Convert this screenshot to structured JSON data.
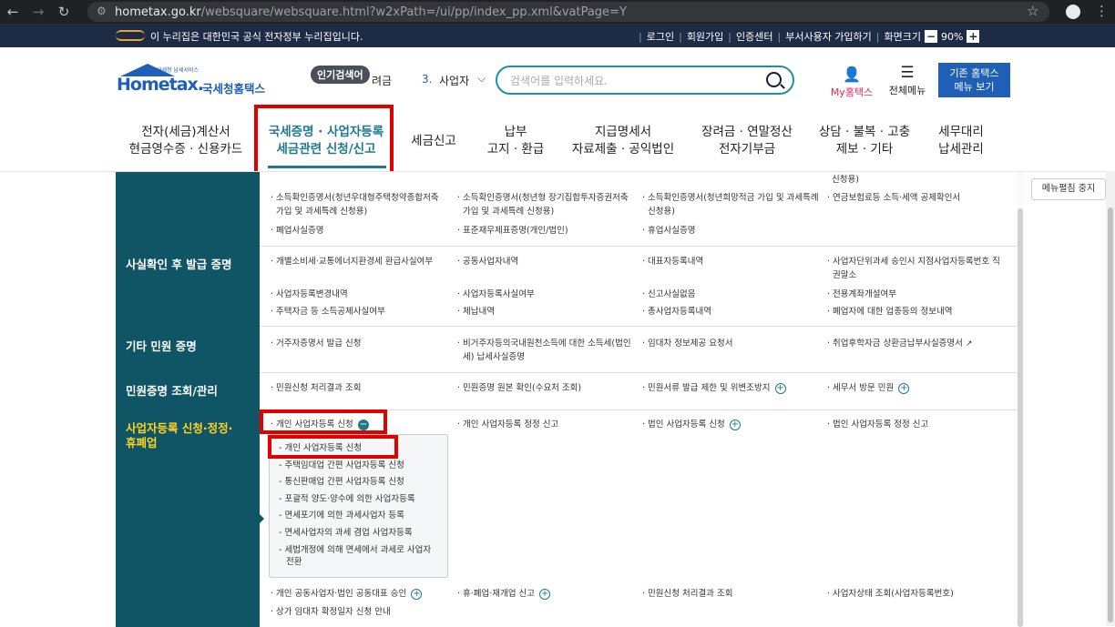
{
  "browser": {
    "back": "←",
    "forward": "→",
    "reload": "↻",
    "url_host": "hometax.go.kr",
    "url_path": "/websquare/websquare.html?w2xPath=/ui/pp/index_pp.xml&vatPage=Y"
  },
  "gov_bar": {
    "notice": "이 누리집은 대한민국 공식 전자정부 누리집입니다.",
    "links": [
      "로그인",
      "회원가입",
      "인증센터",
      "부서사용자 가입하기",
      "화면크기"
    ],
    "zoom": "90%",
    "zoom_minus": "−",
    "zoom_plus": "+"
  },
  "header": {
    "logo_small": "국세청 납세서비스",
    "logo_text": "Hometax.",
    "logo_korean": "국세청홈택스",
    "popular_badge": "인기검색어",
    "popular_prefix": "려금",
    "popular_rank": "3.",
    "popular_item": "사업자",
    "search_placeholder": "검색어를 입력하세요.",
    "my_hometax": "My홈택스",
    "all_menu": "전체메뉴",
    "old_menu_line1": "기존 홈택스",
    "old_menu_line2": "메뉴 보기"
  },
  "gnb": [
    {
      "line1": "전자(세금)계산서",
      "line2": "현금영수증 · 신용카드"
    },
    {
      "line1": "국세증명 · 사업자등록",
      "line2": "세금관련 신청/신고"
    },
    {
      "line1": "세금신고",
      "line2": ""
    },
    {
      "line1": "납부",
      "line2": "고지 · 환급"
    },
    {
      "line1": "지급명세서",
      "line2": "자료제출 · 공익법인"
    },
    {
      "line1": "장려금 · 연말정산",
      "line2": "전자기부금"
    },
    {
      "line1": "상담 · 불복 · 고충",
      "line2": "제보 · 기타"
    },
    {
      "line1": "세무대리",
      "line2": "납세관리"
    }
  ],
  "categories": {
    "fact": "사실확인 후 발급 증명",
    "etc": "기타 민원 증명",
    "inquiry": "민원증명 조회/관리",
    "business_line1": "사업자등록 신청·정정·",
    "business_line2": "휴폐업"
  },
  "rows": {
    "top": {
      "c4_top": "신청용)",
      "c1": [
        "· 소득확인증명서(청년우대형주택청약종합저축",
        "가입 및 과세특례 신청용)"
      ],
      "c2": [
        "· 소득확인증명서(청년형 장기집합투자증권저축",
        "가입 및 과세특례 신청용)"
      ],
      "c3": [
        "· 소득확인증명서(청년희망적금 가입 및 과세특례",
        "신청용)"
      ],
      "c4": "· 연금보험료등 소득·세액 공제확인서",
      "c1b": "· 폐업사실증명",
      "c2b": "· 표준재무제표증명(개인/법인)",
      "c3b": "· 휴업사실증명"
    },
    "fact": {
      "r1": [
        "· 개별소비세·교통에너지환경세 환급사실여부",
        "· 공동사업자내역",
        "· 대표자등록내역",
        "· 사업자단위과세 승인시 지점사업자등록번호 직",
        "권말소"
      ],
      "r2": [
        "· 사업자등록변경내역",
        "· 사업자등록사실여부",
        "· 신고사실없음",
        "· 전용계좌개설여부"
      ],
      "r3": [
        "· 주택자금 등 소득공제사실여부",
        "· 체납내역",
        "· 총사업자등록내역",
        "· 폐업자에 대한 업종등의 정보내역"
      ]
    },
    "etc": {
      "c1": "· 거주자증명서 발급 신청",
      "c2": [
        "· 비거주자등의국내원천소득에 대한 소득세(법인",
        "세) 납세사실증명"
      ],
      "c3": "· 임대차 정보제공 요청서",
      "c4": "· 취업후학자금 상환금납부사실증명서"
    },
    "inquiry": {
      "c1": "· 민원신청 처리결과 조회",
      "c2": "· 민원증명 원본 확인(수요처 조회)",
      "c3": "· 민원서류 발급 제한 및 위변조방지",
      "c4": "· 세무서 방문 민원"
    },
    "business": {
      "c1": "· 개인 사업자등록 신청",
      "c2": "· 개인 사업자등록 정정 신고",
      "c3": "· 법인 사업자등록 신청",
      "c4": "· 법인 사업자등록 정정 신고",
      "submenu": [
        "- 개인 사업자등록 신청",
        "- 주택임대업 간편 사업자등록 신청",
        "- 통신판매업 간편 사업자등록 신청",
        "- 포괄적 양도·양수에 의한 사업자등록",
        "- 면세포기에 의한 과세사업자 등록",
        "- 면세사업자의 과세 겸업 사업자등록",
        "- 세법개정에 의해 면세에서 과세로 사업자",
        "전환"
      ],
      "b1": "· 개인 공동사업자·법인 공동대표 승인",
      "b2": "· 휴·폐업·재개업 신고",
      "b3": "· 민원신청 처리결과 조회",
      "b4": "· 사업자상태 조회(사업자등록번호)",
      "b5": "· 상가 임대차 확정일자 신청 안내"
    }
  },
  "side": {
    "edit_menu": "메뉴펼침 중지"
  },
  "colors": {
    "brand": "#1f5fb5",
    "teal": "#1e7a8a",
    "category_bg": "#0f5565",
    "highlight": "#e00000",
    "yellow": "#ffd21e"
  }
}
